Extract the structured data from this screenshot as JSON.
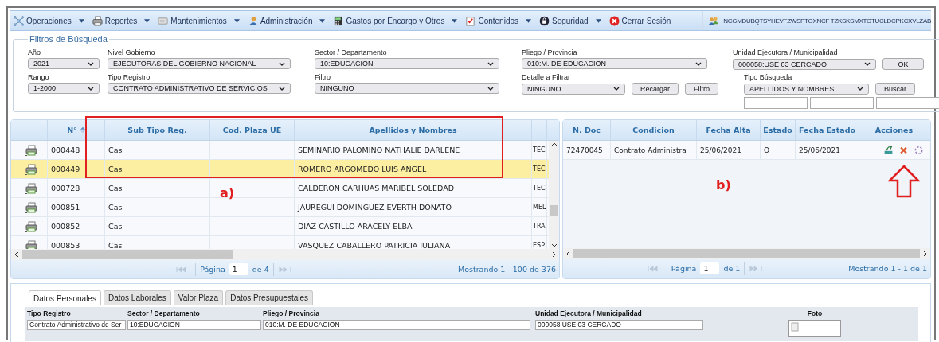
{
  "menu": [
    {
      "label": "Operaciones",
      "dropdown": true
    },
    {
      "label": "Reportes",
      "dropdown": true
    },
    {
      "label": "Mantenimientos",
      "dropdown": true
    },
    {
      "label": "Administración",
      "dropdown": true
    },
    {
      "label": "Gastos por Encargo y Otros",
      "dropdown": true
    },
    {
      "label": "Contenidos",
      "dropdown": true
    },
    {
      "label": "Seguridad",
      "dropdown": true
    },
    {
      "label": "Cerrar Sesión",
      "dropdown": false
    }
  ],
  "user_code": "NCGMDUBQTSYHEVFZWSPTOXNCF TZKSKSMXTOTUCLDCPKCXVLZAB",
  "filters": {
    "title": "Filtros de Búsqueda",
    "rows": [
      [
        {
          "label": "Año",
          "value": "2021"
        },
        {
          "label": "Nivel Gobierno",
          "value": "EJECUTORAS DEL GOBIERNO NACIONAL"
        },
        {
          "label": "Sector / Departamento",
          "value": "10:EDUCACION"
        },
        {
          "label": "Pliego / Provincia",
          "value": "010:M. DE EDUCACION"
        },
        {
          "label": "Unidad Ejecutora / Municipalidad",
          "value": "000058:USE 03 CERCADO",
          "buttons": [
            "OK"
          ]
        }
      ],
      [
        {
          "label": "Rango",
          "value": "1-2000"
        },
        {
          "label": "Tipo Registro",
          "value": "CONTRATO ADMINISTRATIVO DE SERVICIOS"
        },
        {
          "label": "Filtro",
          "value": "NINGUNO"
        },
        {
          "label": "Detalle a Filtrar",
          "value": "NINGUNO",
          "buttons": [
            "Recargar",
            "Filtro"
          ]
        },
        {
          "label": "Tipo Búsqueda",
          "value": "APELLIDOS Y NOMBRES",
          "buttons": [
            "Buscar"
          ]
        }
      ]
    ]
  },
  "registros": {
    "columns": [
      {
        "label": "N°"
      },
      {
        "label": "Sub Tipo Reg."
      },
      {
        "label": "Cod. Plaza UE"
      },
      {
        "label": "Apellidos y Nombres"
      }
    ],
    "rows": [
      {
        "number": "000448",
        "sub_tipo": "Cas",
        "name": "SEMINARIO PALOMINO NATHALIE DARLENE",
        "column_6": "TEC",
        "selected": false
      },
      {
        "number": "000449",
        "sub_tipo": "Cas",
        "name": "ROMERO ARGOMEDO LUIS ANGEL",
        "column_6": "TEC",
        "selected": true
      },
      {
        "number": "000728",
        "sub_tipo": "Cas",
        "name": "CALDERON CARHUAS MARIBEL SOLEDAD",
        "column_6": "TEC",
        "selected": false
      },
      {
        "number": "000851",
        "sub_tipo": "Cas",
        "name": "JAUREGUI DOMINGUEZ EVERTH DONATO",
        "column_6": "MED",
        "selected": false
      },
      {
        "number": "000852",
        "sub_tipo": "Cas",
        "name": "DIAZ CASTILLO ARACELY ELBA",
        "column_6": "TRA",
        "selected": false
      },
      {
        "number": "000853",
        "sub_tipo": "Cas",
        "name": "VASQUEZ CABALLERO PATRICIA JULIANA",
        "column_6": "ESP",
        "selected": false
      }
    ],
    "pager": {
      "page_label": "Página",
      "page": "1",
      "of": "de 4",
      "summary": "Mostrando 1 - 100 de 376"
    }
  },
  "detalle": {
    "columns": [
      {
        "label": "N. Doc"
      },
      {
        "label": "Condicion"
      },
      {
        "label": "Fecha Alta"
      },
      {
        "label": "Estado"
      },
      {
        "label": "Fecha Estado"
      },
      {
        "label": "Acciones"
      }
    ],
    "rows": [
      {
        "n_doc": "72470045",
        "condicion": "Contrato Administra",
        "fecha_alta": "25/06/2021",
        "estado": "O",
        "fecha_estado": "25/06/2021",
        "selected": false
      }
    ],
    "pager": {
      "page_label": "Página",
      "page": "1",
      "of": "de 1",
      "summary": "Mostrando 1 - 1 de 1"
    }
  },
  "annotations": [
    {
      "label": "a)"
    },
    {
      "label": "b)"
    }
  ],
  "tabs": [
    {
      "label": "Datos Personales",
      "selected": true
    },
    {
      "label": "Datos Laborales",
      "selected": false
    },
    {
      "label": "Valor Plaza",
      "selected": false
    },
    {
      "label": "Datos Presupuestales",
      "selected": false
    }
  ],
  "personal": {
    "fields": [
      {
        "label": "Tipo Registro",
        "value": "Contrato Administrativo de Ser"
      },
      {
        "label": "Sector / Departamento",
        "value": "10:EDUCACION"
      },
      {
        "label": "Pliego / Provincia",
        "value": "010:M. DE EDUCACION"
      },
      {
        "label": "Unidad Ejecutora / Municipalidad",
        "value": "000058:USE 03 CERCADO"
      }
    ],
    "photo_label": "Foto"
  }
}
